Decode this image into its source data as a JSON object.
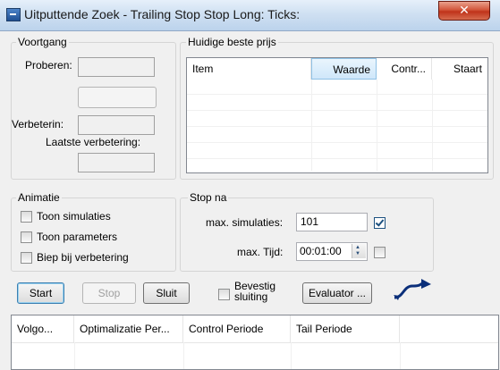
{
  "window": {
    "title": "Uitputtende Zoek - Trailing Stop Stop Long: Ticks:",
    "close_glyph": "✕"
  },
  "progress": {
    "group_label": "Voortgang",
    "try_label": "Proberen:",
    "improve_label": "Verbeterin:",
    "last_improvement_label": "Laatste verbetering:"
  },
  "best_price": {
    "group_label": "Huidige beste prijs",
    "columns": [
      "Item",
      "Waarde",
      "Contr...",
      "Staart"
    ]
  },
  "animation": {
    "group_label": "Animatie",
    "show_simulations": "Toon simulaties",
    "show_parameters": "Toon parameters",
    "beep_on_improvement": "Biep bij verbetering"
  },
  "stop_after": {
    "group_label": "Stop na",
    "max_simulations_label": "max. simulaties:",
    "max_simulations_value": "101",
    "max_simulations_checked": true,
    "max_time_label": "max. Tijd:",
    "max_time_value": "00:01:00",
    "max_time_checked": false
  },
  "buttons": {
    "start": "Start",
    "stop": "Stop",
    "close": "Sluit",
    "confirm_close_line1": "Bevestig",
    "confirm_close_line2": "sluiting",
    "evaluator": "Evaluator ..."
  },
  "results": {
    "columns": [
      "Volgo...",
      "Optimalizatie Per...",
      "Control Periode",
      "Tail Periode"
    ]
  },
  "icons": {
    "app": "app-window-icon",
    "logo": "s-curve-arrow-icon"
  }
}
